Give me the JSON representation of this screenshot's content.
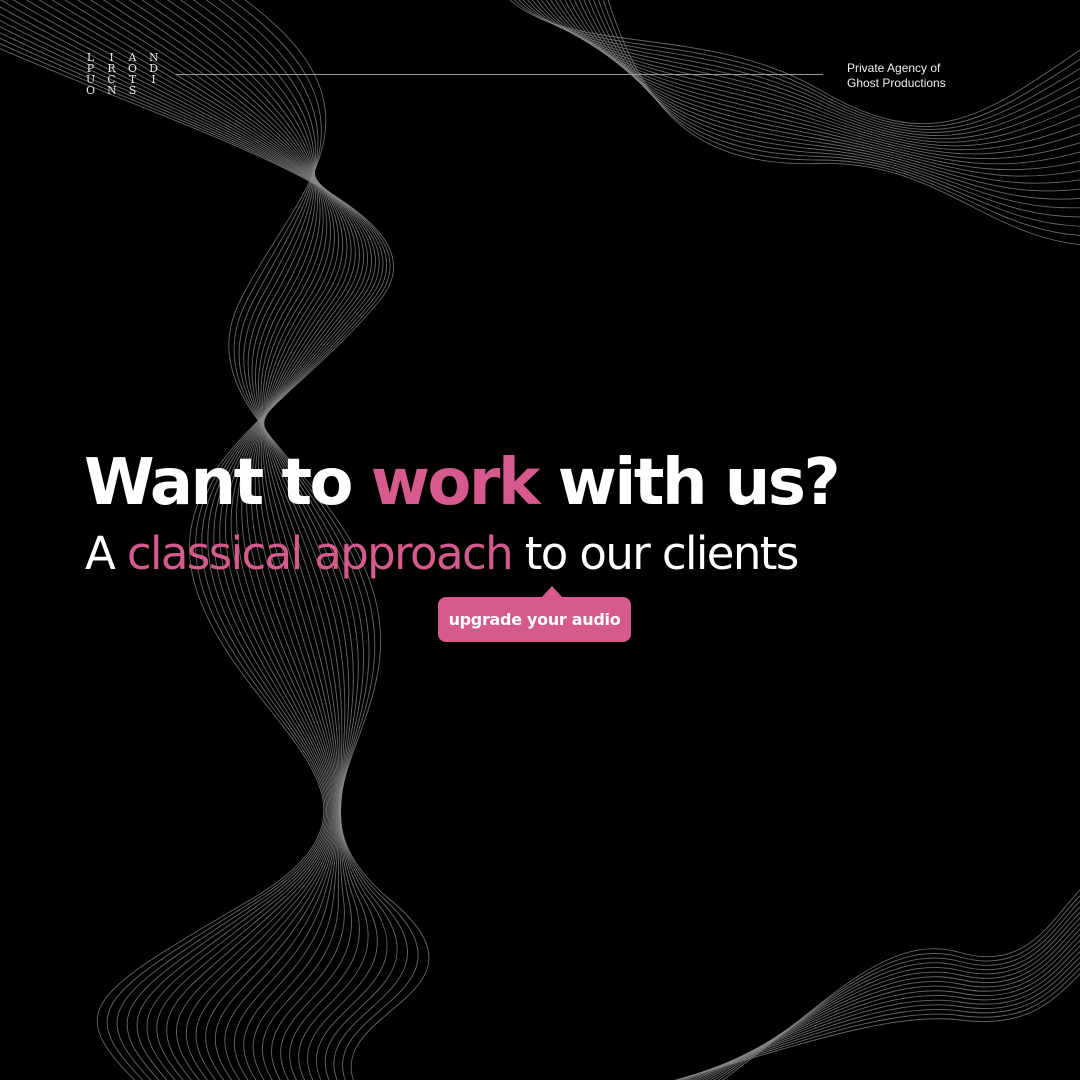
{
  "logo": {
    "rows": [
      [
        "L",
        "I",
        "A",
        "N"
      ],
      [
        "P",
        "R",
        "O",
        "D"
      ],
      [
        "U",
        "C",
        "T",
        "I"
      ],
      [
        "O",
        "N",
        "S",
        ""
      ]
    ]
  },
  "header": {
    "tagline_line1": "Private Agency of",
    "tagline_line2": "Ghost Productions"
  },
  "headline": {
    "part1": "Want to ",
    "accent": "work",
    "part2": " with us?"
  },
  "subline": {
    "part1": "A ",
    "accent": "classical approach",
    "part2": " to our clients"
  },
  "cta": {
    "label": "upgrade your audio"
  },
  "colors": {
    "background": "#000000",
    "accent": "#d65b8c",
    "text": "#ffffff",
    "lines": "#8a8a8a"
  }
}
